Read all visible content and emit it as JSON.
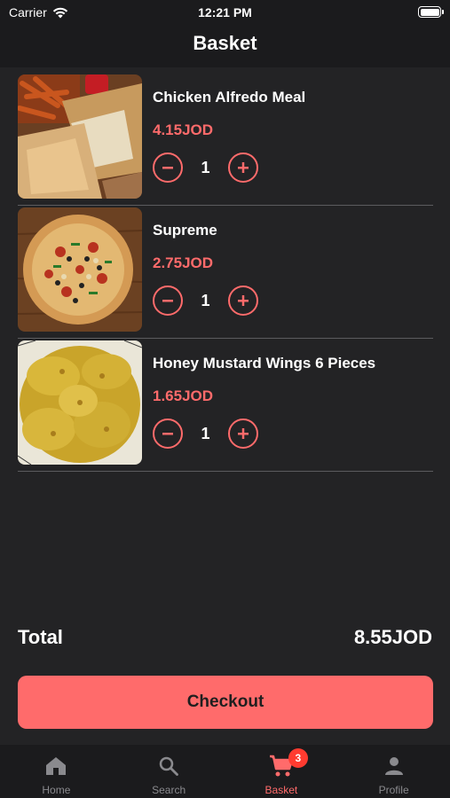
{
  "status_bar": {
    "carrier": "Carrier",
    "time": "12:21 PM"
  },
  "header": {
    "title": "Basket"
  },
  "items": [
    {
      "name": "Chicken Alfredo Meal",
      "price": "4.15JOD",
      "quantity": "1",
      "image": "chicken-alfredo-meal-photo"
    },
    {
      "name": "Supreme",
      "price": "2.75JOD",
      "quantity": "1",
      "image": "supreme-pizza-photo"
    },
    {
      "name": "Honey Mustard Wings 6 Pieces",
      "price": "1.65JOD",
      "quantity": "1",
      "image": "honey-mustard-wings-photo"
    }
  ],
  "total": {
    "label": "Total",
    "value": "8.55JOD"
  },
  "checkout": {
    "label": "Checkout"
  },
  "tabbar": {
    "tabs": [
      {
        "label": "Home",
        "icon": "home-icon"
      },
      {
        "label": "Search",
        "icon": "search-icon"
      },
      {
        "label": "Basket",
        "icon": "cart-icon",
        "badge": "3",
        "active": true
      },
      {
        "label": "Profile",
        "icon": "person-icon"
      }
    ]
  },
  "colors": {
    "accent": "#ff6b6b",
    "background": "#232325",
    "badge": "#ff3b30"
  }
}
